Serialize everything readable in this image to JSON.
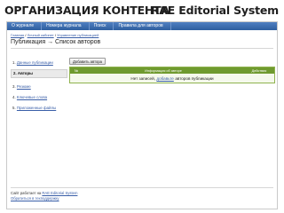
{
  "slide": {
    "title_left": "ОРГАНИЗАЦИЯ КОНТЕНТА",
    "title_right": "RAE Editorial System"
  },
  "colors": {
    "nav_bar": "#3a6bb0",
    "table_header": "#6f9a2f",
    "link": "#3a5fa8"
  },
  "nav": {
    "items": [
      {
        "label": "О журнале"
      },
      {
        "label": "Номера журнала"
      },
      {
        "label": "Поиск"
      },
      {
        "label": "Правила для авторов"
      }
    ]
  },
  "breadcrumb": {
    "items": [
      "Главная",
      "Личный кабинет",
      "Управление публикацией"
    ]
  },
  "page": {
    "title": "Публикация → Список авторов"
  },
  "sidebar": {
    "items": [
      {
        "number": "1.",
        "label": "Данные публикации"
      },
      {
        "number": "2.",
        "label": "Авторы"
      },
      {
        "number": "3.",
        "label": "Резюме"
      },
      {
        "number": "4.",
        "label": "Ключевые слова"
      },
      {
        "number": "5.",
        "label": "Приложенные файлы"
      }
    ]
  },
  "main": {
    "add_author_button": "Добавить автора",
    "table": {
      "headers": {
        "num": "№",
        "info": "Информация об авторе",
        "actions": "Действия"
      },
      "empty_prefix": "Нет записей,",
      "empty_link": "добавьте",
      "empty_suffix": "авторов публикации"
    }
  },
  "footer": {
    "line1_prefix": "Сайт работает на",
    "line1_link": "RAE Editorial System",
    "line2_link": "Обратиться в техподдержку"
  }
}
